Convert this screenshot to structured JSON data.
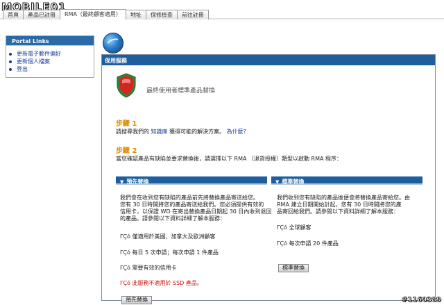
{
  "watermark": {
    "logo": "MOBILE01",
    "id": "#1160389"
  },
  "tabs": [
    {
      "label": "首頁"
    },
    {
      "label": "產品已註冊"
    },
    {
      "label": "RMA（最終顧客適用）"
    },
    {
      "label": "地址"
    },
    {
      "label": "保修檢查"
    },
    {
      "label": "前往註冊"
    }
  ],
  "portal": {
    "title": "Portal Links",
    "links": [
      {
        "label": "更新電子郵件偏好"
      },
      {
        "label": "更新個人檔案"
      },
      {
        "label": "登出"
      }
    ]
  },
  "panel": {
    "title": "保用服務",
    "banner": "最終使用者標準產品替換",
    "step1": {
      "title": "步驟 1",
      "text_prefix": "請搜尋我們的",
      "link_kb": "知識庫",
      "text_mid": "獲得可能的解決方案。",
      "link_why": "為什麼?"
    },
    "step2": {
      "title": "步驟 2",
      "text": "當您確認產品有缺陷並要求替換後，請選擇以下 RMA （退貨授權）類型以啟動 RMA 程序："
    },
    "advance": {
      "title": "預先替換",
      "lines": [
        "我們會在收到您有缺陷的產品前先將替換產品寄送給您。",
        "您有 30 日時間將您的產品寄送給我們。您必須提供有效的",
        "信用卡，以保證 WD 在寄出替換產品日期起 30 日內收到退回",
        "的產品。請參閱以下資料詳細了解本服務："
      ],
      "items": [
        "ΓÇó 僅適用於美國、加拿大及歐洲顧客",
        "ΓÇó 每日 5 次申請；每次申請 1 件產品",
        "ΓÇó 需要有效的信用卡"
      ],
      "warning": "ΓÇó 此服務不適用於 SSD 產品。",
      "button": "預先替換"
    },
    "standard": {
      "title": "標準替換",
      "lines": [
        "我們收到您有缺陷的產品後便會將替換產品寄給您。由",
        "RMA 建立日期開始計起，您有 30 日時間將您的產",
        "品寄回給我們。請參閱以下資料詳細了解本服務："
      ],
      "items": [
        "ΓÇó 全球顧客",
        "ΓÇó 每次申請 20 件產品"
      ],
      "button": "標準替換"
    }
  },
  "colors": {
    "header_blue": "#1d5f9e",
    "step_orange": "#e08a00",
    "warn_red": "#d01010"
  }
}
